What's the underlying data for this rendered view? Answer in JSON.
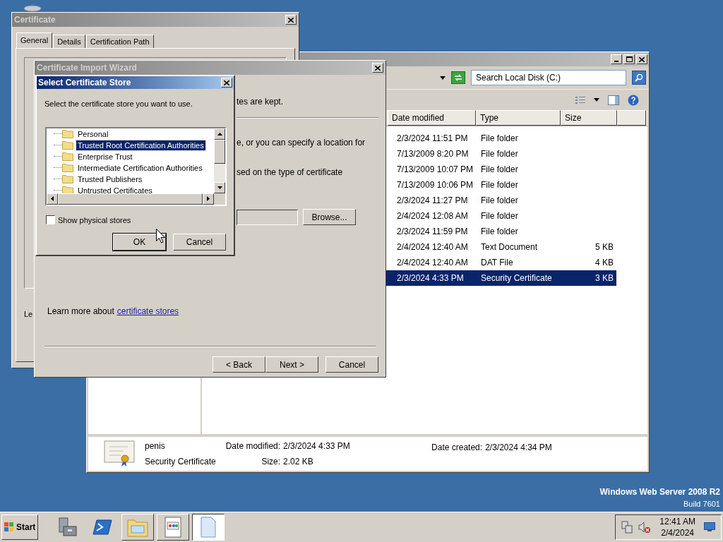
{
  "certificate": {
    "title": "Certificate",
    "tabs": [
      {
        "label": "General",
        "selected": true
      },
      {
        "label": "Details",
        "selected": false
      },
      {
        "label": "Certification Path",
        "selected": false
      }
    ],
    "partial_text": "Le"
  },
  "explorer": {
    "search_placeholder": "Search Local Disk (C:)",
    "columns": [
      "Date modified",
      "Type",
      "Size"
    ],
    "rows": [
      {
        "date": "2/3/2024 11:51 PM",
        "type": "File folder",
        "selected": false
      },
      {
        "date": "7/13/2009 8:20 PM",
        "type": "File folder",
        "selected": false
      },
      {
        "date": "7/13/2009 10:07 PM",
        "type": "File folder",
        "selected": false
      },
      {
        "date": "7/13/2009 10:06 PM",
        "type": "File folder",
        "selected": false
      },
      {
        "date": "2/3/2024 11:27 PM",
        "type": "File folder",
        "selected": false
      },
      {
        "date": "2/4/2024 12:08 AM",
        "type": "File folder",
        "selected": false
      },
      {
        "date": "2/3/2024 11:59 PM",
        "type": "File folder",
        "selected": false
      },
      {
        "date": "2/4/2024 12:40 AM",
        "type": "Text Document",
        "size": "5 KB",
        "selected": false
      },
      {
        "date": "2/4/2024 12:40 AM",
        "type": "DAT File",
        "size": "4 KB",
        "selected": false
      },
      {
        "date": "2/3/2024 4:33 PM",
        "type": "Security Certificate",
        "size": "3 KB",
        "selected": true
      }
    ],
    "details": {
      "name": "penis",
      "type": "Security Certificate",
      "modified_label": "Date modified:",
      "modified": "2/3/2024 4:33 PM",
      "created_label": "Date created:",
      "created": "2/3/2024 4:34 PM",
      "size_label": "Size:",
      "size": "2.02 KB"
    }
  },
  "wizard": {
    "title": "Certificate Import Wizard",
    "fragments": [
      "tes are kept.",
      "e, or you can specify a location for",
      "sed on the type of certificate"
    ],
    "browse": "Browse...",
    "learn_more": "Learn more about",
    "link": "certificate stores",
    "buttons": [
      "< Back",
      "Next >",
      "Cancel"
    ]
  },
  "store_dialog": {
    "title": "Select Certificate Store",
    "prompt": "Select the certificate store you want to use.",
    "stores": [
      {
        "label": "Personal",
        "selected": false
      },
      {
        "label": "Trusted Root Certification Authorities",
        "selected": true
      },
      {
        "label": "Enterprise Trust",
        "selected": false
      },
      {
        "label": "Intermediate Certification Authorities",
        "selected": false
      },
      {
        "label": "Trusted Publishers",
        "selected": false
      },
      {
        "label": "Untrusted Certificates",
        "selected": false
      }
    ],
    "show_physical": {
      "label": "Show physical stores",
      "checked": false
    },
    "buttons": [
      "OK",
      "Cancel"
    ]
  },
  "desktop": {
    "os_label": "Windows Web Server 2008 R2",
    "build": "Build 7601"
  },
  "taskbar": {
    "start": "Start",
    "apps": [
      {
        "kind": "server",
        "selected": false
      },
      {
        "kind": "powershell",
        "selected": false
      },
      {
        "kind": "explorer",
        "selected": false
      },
      {
        "kind": "browser",
        "selected": false
      },
      {
        "kind": "document",
        "selected": true
      }
    ],
    "time": "12:41 AM",
    "date": "2/4/2024"
  }
}
